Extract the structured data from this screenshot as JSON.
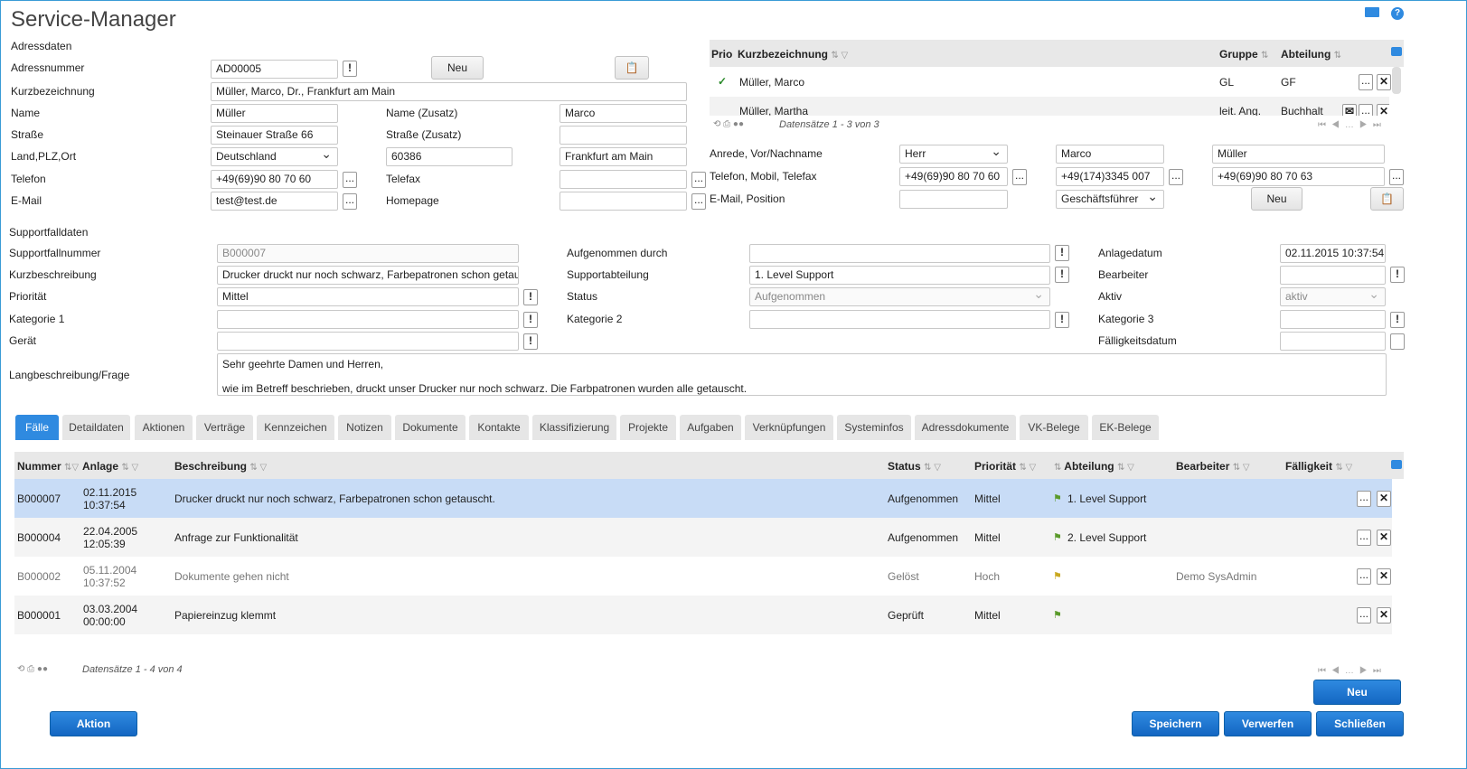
{
  "app": {
    "title": "Service-Manager"
  },
  "address": {
    "section": "Adressdaten",
    "nr_label": "Adressnummer",
    "nr": "AD00005",
    "new_label": "Neu",
    "short_label": "Kurzbezeichnung",
    "short": "Müller, Marco, Dr., Frankfurt am Main",
    "name_label": "Name",
    "name": "Müller",
    "name2_label": "Name (Zusatz)",
    "name2": "Marco",
    "street_label": "Straße",
    "street": "Steinauer Straße 66",
    "street2_label": "Straße (Zusatz)",
    "city_label": "Land,PLZ,Ort",
    "country": "Deutschland",
    "zip": "60386",
    "city": "Frankfurt am Main",
    "phone_label": "Telefon",
    "phone": "+49(69)90 80 70 60",
    "fax_label": "Telefax",
    "email_label": "E-Mail",
    "email": "test@test.de",
    "homepage_label": "Homepage"
  },
  "contacts": {
    "headers": {
      "prio": "Prio",
      "short": "Kurzbezeichnung",
      "group": "Gruppe",
      "dept": "Abteilung"
    },
    "rows": [
      {
        "name": "Müller, Marco",
        "group": "GL",
        "dept": "GF"
      },
      {
        "name": "Müller, Martha",
        "group": "leit. Ang.",
        "dept": "Buchhalt"
      }
    ],
    "footer": "Datensätze 1 - 3 von 3",
    "salutation_label": "Anrede, Vor/Nachname",
    "salutation": "Herr",
    "first": "Marco",
    "last": "Müller",
    "phones_label": "Telefon, Mobil, Telefax",
    "phone": "+49(69)90 80 70 60",
    "mobile": "+49(174)3345 007",
    "fax": "+49(69)90 80 70 63",
    "mail_label": "E-Mail, Position",
    "position": "Geschäftsführer",
    "new_label": "Neu"
  },
  "support": {
    "section": "Supportfalldaten",
    "nr_label": "Supportfallnummer",
    "nr": "B000007",
    "desc_label": "Kurzbeschreibung",
    "desc": "Drucker druckt nur noch schwarz, Farbepatronen schon getaus",
    "prio_label": "Priorität",
    "prio": "Mittel",
    "cat1_label": "Kategorie 1",
    "device_label": "Gerät",
    "long_label": "Langbeschreibung/Frage",
    "long_line1": "Sehr geehrte Damen und Herren,",
    "long_line2": "wie im Betreff beschrieben, druckt unser Drucker nur noch schwarz. Die Farbpatronen wurden alle getauscht.",
    "by_label": "Aufgenommen durch",
    "dept_label": "Supportabteilung",
    "dept": "1. Level Support",
    "status_label": "Status",
    "status": "Aufgenommen",
    "cat2_label": "Kategorie 2",
    "created_label": "Anlagedatum",
    "created": "02.11.2015 10:37:54",
    "editor_label": "Bearbeiter",
    "active_label": "Aktiv",
    "active": "aktiv",
    "cat3_label": "Kategorie 3",
    "due_label": "Fälligkeitsdatum"
  },
  "tabs": [
    "Fälle",
    "Detaildaten",
    "Aktionen",
    "Verträge",
    "Kennzeichen",
    "Notizen",
    "Dokumente",
    "Kontakte",
    "Klassifizierung",
    "Projekte",
    "Aufgaben",
    "Verknüpfungen",
    "Systeminfos",
    "Adressdokumente",
    "VK-Belege",
    "EK-Belege"
  ],
  "cases": {
    "headers": {
      "nr": "Nummer",
      "created": "Anlage",
      "desc": "Beschreibung",
      "status": "Status",
      "prio": "Priorität",
      "dept": "Abteilung",
      "editor": "Bearbeiter",
      "due": "Fälligkeit"
    },
    "rows": [
      {
        "nr": "B000007",
        "date": "02.11.2015",
        "time": "10:37:54",
        "desc": "Drucker druckt nur noch schwarz, Farbepatronen schon getauscht.",
        "status": "Aufgenommen",
        "prio": "Mittel",
        "dept": "1. Level Support",
        "editor": ""
      },
      {
        "nr": "B000004",
        "date": "22.04.2005",
        "time": "12:05:39",
        "desc": "Anfrage zur Funktionalität",
        "status": "Aufgenommen",
        "prio": "Mittel",
        "dept": "2. Level Support",
        "editor": ""
      },
      {
        "nr": "B000002",
        "date": "05.11.2004",
        "time": "10:37:52",
        "desc": "Dokumente gehen nicht",
        "status": "Gelöst",
        "prio": "Hoch",
        "dept": "",
        "editor": "Demo SysAdmin"
      },
      {
        "nr": "B000001",
        "date": "03.03.2004",
        "time": "00:00:00",
        "desc": "Papiereinzug klemmt",
        "status": "Geprüft",
        "prio": "Mittel",
        "dept": "",
        "editor": ""
      }
    ],
    "footer": "Datensätze 1 - 4 von 4",
    "new_label": "Neu"
  },
  "actions": {
    "action": "Aktion",
    "save": "Speichern",
    "discard": "Verwerfen",
    "close": "Schließen"
  }
}
